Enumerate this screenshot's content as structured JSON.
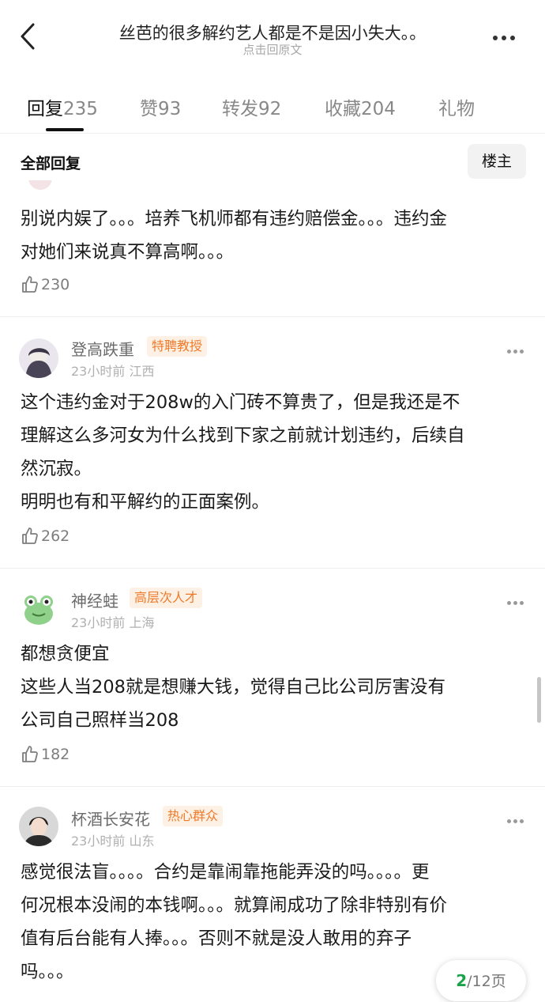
{
  "header": {
    "title": "丝芭的很多解约艺人都是不是因小失大。。",
    "subtitle": "点击回原文"
  },
  "tabs": [
    {
      "label": "回复",
      "count": "235"
    },
    {
      "label": "赞",
      "count": "93"
    },
    {
      "label": "转发",
      "count": "92"
    },
    {
      "label": "收藏",
      "count": "204"
    },
    {
      "label": "礼物",
      "count": ""
    }
  ],
  "filter": {
    "all_replies_label": "全部回复",
    "op_button_label": "楼主"
  },
  "comments": [
    {
      "body": [
        "别说内娱了。。。培养飞机师都有违约赔偿金。。。违约金",
        "对她们来说真不算高啊。。。"
      ],
      "likes": "230"
    },
    {
      "user": "登高跌重",
      "badge": "特聘教授",
      "time": "23小时前",
      "location": "江西",
      "body": [
        "这个违约金对于208w的入门砖不算贵了，但是我还是不",
        "理解这么多河女为什么找到下家之前就计划违约，后续自",
        "然沉寂。",
        "明明也有和平解约的正面案例。"
      ],
      "likes": "262"
    },
    {
      "user": "神经蛙",
      "badge": "高层次人才",
      "time": "23小时前",
      "location": "上海",
      "body": [
        "都想贪便宜",
        "这些人当208就是想赚大钱，觉得自己比公司厉害没有",
        "公司自己照样当208"
      ],
      "likes": "182"
    },
    {
      "user": "杯酒长安花",
      "badge": "热心群众",
      "time": "23小时前",
      "location": "山东",
      "body": [
        "感觉很法盲。。。。合约是靠闹靠拖能弄没的吗。。。。更",
        "何况根本没闹的本钱啊。。。就算闹成功了除非特别有价",
        "值有后台能有人捧。。。否则不就是没人敢用的弃子",
        "吗。。。"
      ],
      "likes": ""
    }
  ],
  "pager": {
    "current": "2",
    "total_label": "/12页"
  },
  "colors": {
    "badge_text": "#f07a2a",
    "badge_bg": "#fdf0e4",
    "pager_current": "#1aa34a"
  }
}
